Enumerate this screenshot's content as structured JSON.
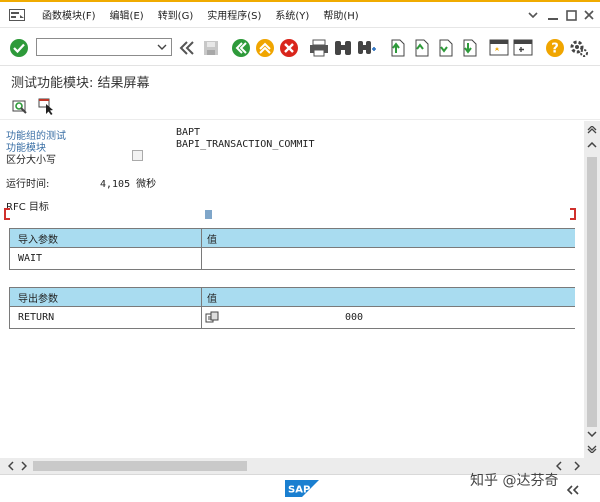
{
  "menu": {
    "items": [
      "函数模块(F)",
      "编辑(E)",
      "转到(G)",
      "实用程序(S)",
      "系统(Y)",
      "帮助(H)"
    ]
  },
  "toolbar": {
    "command_value": ""
  },
  "title": "测试功能模块: 结果屏幕",
  "fields": {
    "group_label": "功能组的测试",
    "group_value": "BAPT",
    "module_label": "功能模块",
    "module_value": "BAPI_TRANSACTION_COMMIT",
    "case_label": "区分大小写",
    "runtime_label": "运行时间:",
    "runtime_value": "4,105 微秒",
    "rfc_label": "RFC 目标"
  },
  "import_table": {
    "headers": [
      "导入参数",
      "值"
    ],
    "rows": [
      {
        "param": "WAIT",
        "value": ""
      }
    ]
  },
  "export_table": {
    "headers": [
      "导出参数",
      "值"
    ],
    "rows": [
      {
        "param": "RETURN",
        "value": "000"
      }
    ]
  },
  "statusbar": {
    "logo": "SAP"
  },
  "watermark": "知乎 @达芬奇",
  "colors": {
    "accent": "#f0ab00",
    "table_header": "#a9dcf0",
    "label_blue": "#3a6fa5",
    "sap_blue": "#1a7fd0"
  }
}
